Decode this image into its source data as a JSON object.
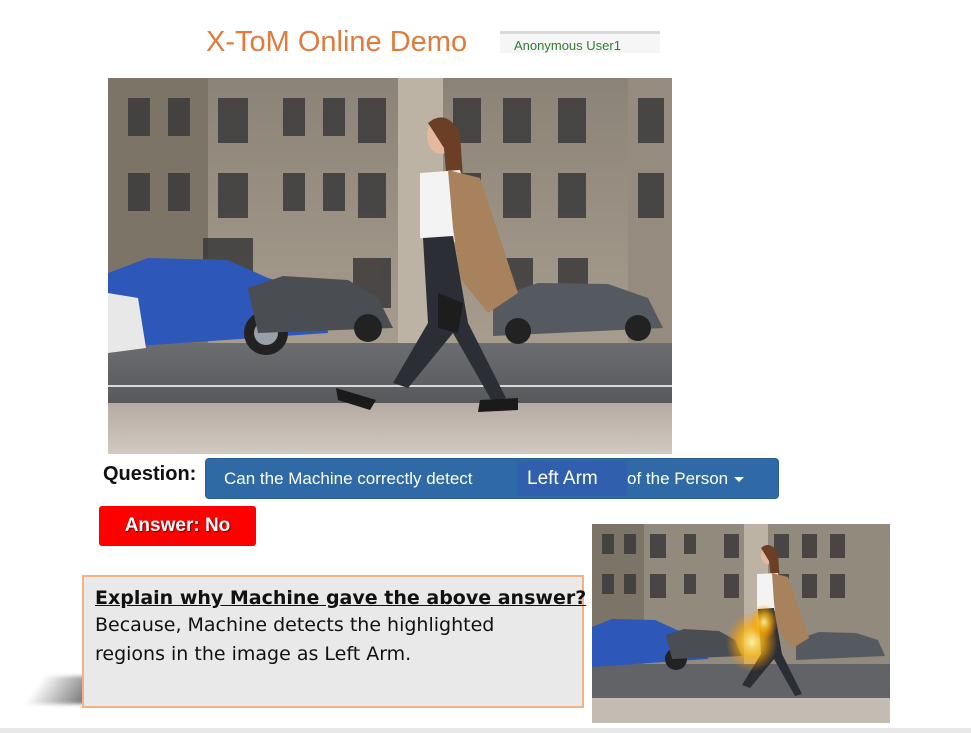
{
  "header": {
    "title": "X-ToM Online Demo",
    "user": "Anonymous User1"
  },
  "main_image": {
    "alt": "Woman walking on a city street past parked cars"
  },
  "question": {
    "label": "Question:",
    "prefix": "Can the Machine correctly detect",
    "selected_part": "Left Arm",
    "suffix": "of the Person"
  },
  "answer": {
    "text": "Answer: No",
    "color": "#ff0000"
  },
  "explanation": {
    "title": "Explain why Machine gave the above answer?",
    "body": "Because, Machine detects the highlighted regions in the image as Left Arm."
  },
  "heatmap_image": {
    "alt": "Same street photo with highlighted regions near the left arm"
  },
  "colors": {
    "title": "#e07b3c",
    "accent": "#2f6aa6",
    "user": "#2e7d32"
  }
}
